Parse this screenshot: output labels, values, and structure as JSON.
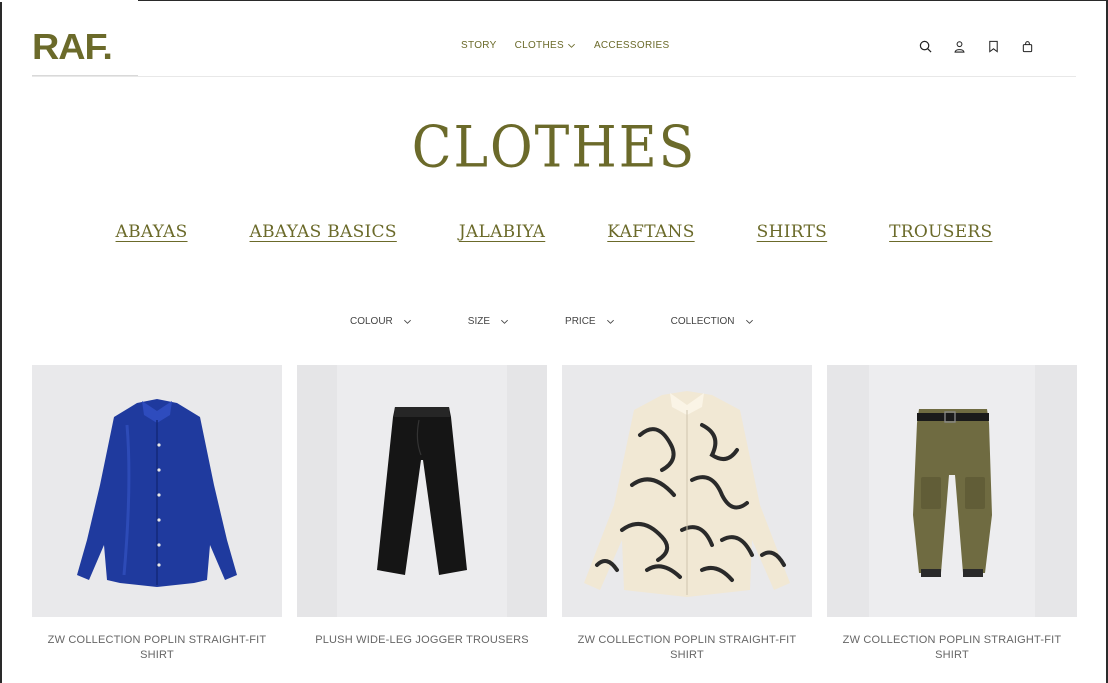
{
  "brand": {
    "logo_text": "RAF."
  },
  "nav": {
    "items": [
      {
        "label": "STORY",
        "has_dropdown": false
      },
      {
        "label": "CLOTHES",
        "has_dropdown": true
      },
      {
        "label": "ACCESSORIES",
        "has_dropdown": false
      }
    ]
  },
  "header_icons": [
    "search-icon",
    "user-icon",
    "bookmark-icon",
    "shopping-bag-icon"
  ],
  "page": {
    "title": "CLOTHES"
  },
  "categories": [
    "ABAYAS",
    "ABAYAS BASICS",
    "JALABIYA",
    "KAFTANS",
    "SHIRTS",
    "TROUSERS"
  ],
  "filters": [
    "COLOUR",
    "SIZE",
    "PRICE",
    "COLLECTION"
  ],
  "products": [
    {
      "name": "ZW COLLECTION POPLIN STRAIGHT-FIT SHIRT",
      "image": "blue-satin-shirt"
    },
    {
      "name": "PLUSH WIDE-LEG JOGGER TROUSERS",
      "image": "black-wide-trousers"
    },
    {
      "name": "ZW COLLECTION POPLIN STRAIGHT-FIT SHIRT",
      "image": "printed-calligraphy-shirt"
    },
    {
      "name": "ZW COLLECTION POPLIN STRAIGHT-FIT SHIRT",
      "image": "olive-cargo-trousers"
    }
  ],
  "colors": {
    "brand": "#6b6a2a",
    "text": "#666666",
    "image_bg": "#e9e9eb"
  }
}
